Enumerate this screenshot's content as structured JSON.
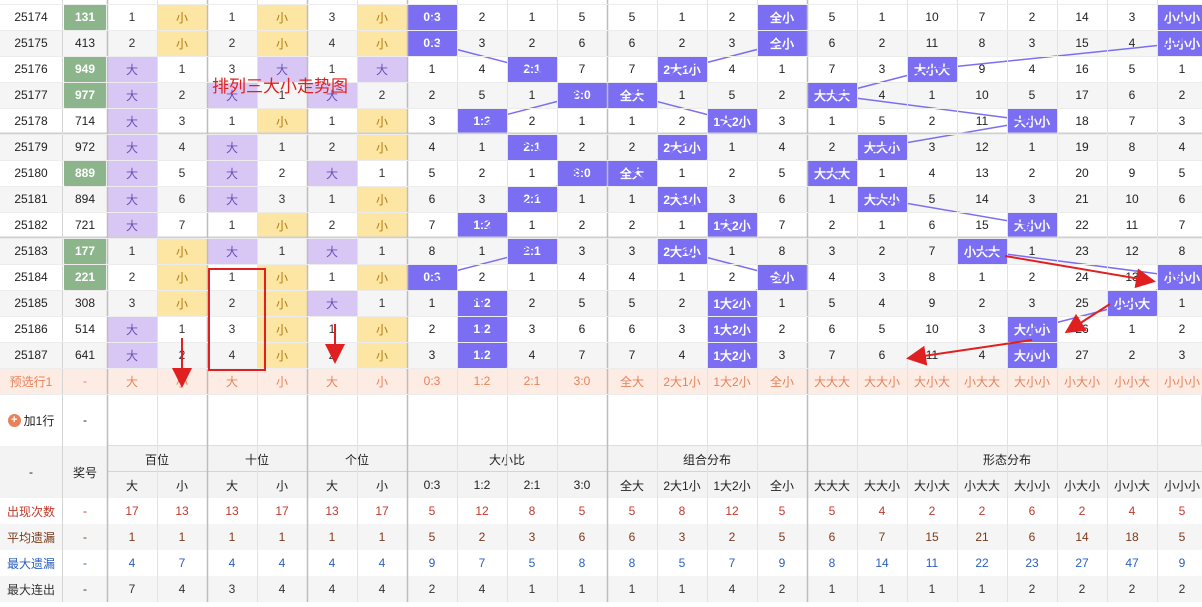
{
  "annotation": {
    "title": "排列三大小走势图"
  },
  "colors": {
    "accent": "#7b6ef2",
    "green": "#8cb58c",
    "purple_bg": "#d8c7f4",
    "yellow_bg": "#fde5a4",
    "red": "#e02020",
    "forecast_text": "#e8815a"
  },
  "columns": {
    "groups": [
      {
        "label": "百位",
        "subs": [
          "大",
          "小"
        ]
      },
      {
        "label": "十位",
        "subs": [
          "大",
          "小"
        ]
      },
      {
        "label": "个位",
        "subs": [
          "大",
          "小"
        ]
      },
      {
        "label": "大小比",
        "subs": [
          "0:3",
          "1:2",
          "2:1",
          "3:0"
        ]
      },
      {
        "label": "组合分布",
        "subs": [
          "全大",
          "2大1小",
          "1大2小",
          "全小"
        ]
      },
      {
        "label": "形态分布",
        "subs": [
          "大大大",
          "大大小",
          "大小大",
          "小大大",
          "大小小",
          "小大小",
          "小小大",
          "小小小"
        ]
      }
    ],
    "issue_label": "-",
    "draw_label": "奖号"
  },
  "rows": [
    {
      "issue": "25174",
      "draw": "131",
      "c": [
        "1",
        "小",
        "1",
        "小",
        "3",
        "小",
        "0:3",
        "2",
        "1",
        "5",
        "5",
        "1",
        "2",
        "全小",
        "5",
        "1",
        "10",
        "7",
        "2",
        "14",
        "3",
        "小小小"
      ]
    },
    {
      "issue": "25175",
      "draw": "413",
      "c": [
        "2",
        "小",
        "2",
        "小",
        "4",
        "小",
        "0:3",
        "3",
        "2",
        "6",
        "6",
        "2",
        "3",
        "全小",
        "6",
        "2",
        "11",
        "8",
        "3",
        "15",
        "4",
        "小小小"
      ]
    },
    {
      "issue": "25176",
      "draw": "949",
      "c": [
        "大",
        "1",
        "3",
        "大",
        "1",
        "大",
        "1",
        "4",
        "2:1",
        "7",
        "7",
        "2大1小",
        "4",
        "1",
        "7",
        "3",
        "大小大",
        "9",
        "4",
        "16",
        "5",
        "1"
      ]
    },
    {
      "issue": "25177",
      "draw": "977",
      "c": [
        "大",
        "2",
        "大",
        "1",
        "大",
        "2",
        "2",
        "5",
        "1",
        "3:0",
        "全大",
        "1",
        "5",
        "2",
        "大大大",
        "4",
        "1",
        "10",
        "5",
        "17",
        "6",
        "2"
      ]
    },
    {
      "issue": "25178",
      "draw": "714",
      "c": [
        "大",
        "3",
        "1",
        "小",
        "1",
        "小",
        "3",
        "1:2",
        "2",
        "1",
        "1",
        "2",
        "1大2小",
        "3",
        "1",
        "5",
        "2",
        "11",
        "大小小",
        "18",
        "7",
        "3"
      ]
    },
    {
      "issue": "25179",
      "draw": "972",
      "c": [
        "大",
        "4",
        "大",
        "1",
        "2",
        "小",
        "4",
        "1",
        "2:1",
        "2",
        "2",
        "2大1小",
        "1",
        "4",
        "2",
        "大大小",
        "3",
        "12",
        "1",
        "19",
        "8",
        "4"
      ]
    },
    {
      "issue": "25180",
      "draw": "889",
      "c": [
        "大",
        "5",
        "大",
        "2",
        "大",
        "1",
        "5",
        "2",
        "1",
        "3:0",
        "全大",
        "1",
        "2",
        "5",
        "大大大",
        "1",
        "4",
        "13",
        "2",
        "20",
        "9",
        "5"
      ]
    },
    {
      "issue": "25181",
      "draw": "894",
      "c": [
        "大",
        "6",
        "大",
        "3",
        "1",
        "小",
        "6",
        "3",
        "2:1",
        "1",
        "1",
        "2大1小",
        "3",
        "6",
        "1",
        "大大小",
        "5",
        "14",
        "3",
        "21",
        "10",
        "6"
      ]
    },
    {
      "issue": "25182",
      "draw": "721",
      "c": [
        "大",
        "7",
        "1",
        "小",
        "2",
        "小",
        "7",
        "1:2",
        "1",
        "2",
        "2",
        "1",
        "1大2小",
        "7",
        "2",
        "1",
        "6",
        "15",
        "大小小",
        "22",
        "11",
        "7"
      ]
    },
    {
      "issue": "25183",
      "draw": "177",
      "c": [
        "1",
        "小",
        "大",
        "1",
        "大",
        "1",
        "8",
        "1",
        "2:1",
        "3",
        "3",
        "2大1小",
        "1",
        "8",
        "3",
        "2",
        "7",
        "小大大",
        "1",
        "23",
        "12",
        "8"
      ]
    },
    {
      "issue": "25184",
      "draw": "221",
      "c": [
        "2",
        "小",
        "1",
        "小",
        "1",
        "小",
        "0:3",
        "2",
        "1",
        "4",
        "4",
        "1",
        "2",
        "全小",
        "4",
        "3",
        "8",
        "1",
        "2",
        "24",
        "13",
        "小小小"
      ]
    },
    {
      "issue": "25185",
      "draw": "308",
      "c": [
        "3",
        "小",
        "2",
        "小",
        "大",
        "1",
        "1",
        "1:2",
        "2",
        "5",
        "5",
        "2",
        "1大2小",
        "1",
        "5",
        "4",
        "9",
        "2",
        "3",
        "25",
        "小小大",
        "1"
      ]
    },
    {
      "issue": "25186",
      "draw": "514",
      "c": [
        "大",
        "1",
        "3",
        "小",
        "1",
        "小",
        "2",
        "1:2",
        "3",
        "6",
        "6",
        "3",
        "1大2小",
        "2",
        "6",
        "5",
        "10",
        "3",
        "大小小",
        "26",
        "1",
        "2"
      ]
    },
    {
      "issue": "25187",
      "draw": "641",
      "c": [
        "大",
        "2",
        "4",
        "小",
        "2",
        "小",
        "3",
        "1:2",
        "4",
        "7",
        "7",
        "4",
        "1大2小",
        "3",
        "7",
        "6",
        "11",
        "4",
        "大小小",
        "27",
        "2",
        "3"
      ]
    }
  ],
  "forecast": {
    "label": "预选行1",
    "draw": "-",
    "c": [
      "大",
      "小",
      "大",
      "小",
      "大",
      "小",
      "0:3",
      "1:2",
      "2:1",
      "3:0",
      "全大",
      "2大1小",
      "1大2小",
      "全小",
      "大大大",
      "大大小",
      "大小大",
      "小大大",
      "大小小",
      "小大小",
      "小小大",
      "小小小"
    ]
  },
  "add_row": {
    "label": "加1行",
    "draw": "-"
  },
  "stats": [
    {
      "label": "出现次数",
      "draw": "-",
      "color": "#c0392b",
      "c": [
        "17",
        "13",
        "13",
        "17",
        "13",
        "17",
        "5",
        "12",
        "8",
        "5",
        "5",
        "8",
        "12",
        "5",
        "5",
        "4",
        "2",
        "2",
        "6",
        "2",
        "4",
        "5"
      ]
    },
    {
      "label": "平均遗漏",
      "draw": "-",
      "color": "#7a3a1a",
      "c": [
        "1",
        "1",
        "1",
        "1",
        "1",
        "1",
        "5",
        "2",
        "3",
        "6",
        "6",
        "3",
        "2",
        "5",
        "6",
        "7",
        "15",
        "21",
        "6",
        "14",
        "18",
        "5"
      ]
    },
    {
      "label": "最大遗漏",
      "draw": "-",
      "color": "#2a5fbf",
      "c": [
        "4",
        "7",
        "4",
        "4",
        "4",
        "4",
        "9",
        "7",
        "5",
        "8",
        "8",
        "5",
        "7",
        "9",
        "8",
        "14",
        "11",
        "22",
        "23",
        "27",
        "47",
        "9"
      ]
    },
    {
      "label": "最大连出",
      "draw": "-",
      "color": "#333",
      "c": [
        "7",
        "4",
        "3",
        "4",
        "4",
        "4",
        "2",
        "4",
        "1",
        "1",
        "1",
        "1",
        "4",
        "2",
        "1",
        "1",
        "1",
        "1",
        "2",
        "2",
        "2",
        "2"
      ]
    }
  ]
}
